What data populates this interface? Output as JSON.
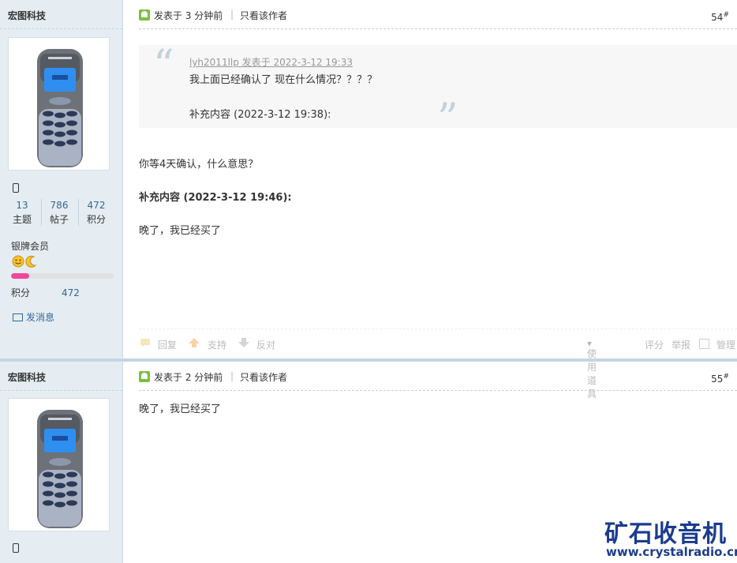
{
  "posts": [
    {
      "author": "宏图科技",
      "stats": [
        {
          "num": "13",
          "label": "主题"
        },
        {
          "num": "786",
          "label": "帖子"
        },
        {
          "num": "472",
          "label": "积分"
        }
      ],
      "rank": "银牌会员",
      "rank_progress": 0.18,
      "points_label": "积分",
      "points_value": "472",
      "send_msg": "发消息",
      "post_time": "发表于 3 分钟前",
      "only_author": "只看该作者",
      "floor": "54",
      "floor_mark": "#",
      "quote": {
        "author_line": "lyh2011llp 发表于 2022-3-12 19:33",
        "line1": "我上面已经确认了        现在什么情况？？？？",
        "line2": "补充内容 (2022-3-12 19:38):"
      },
      "text1": "你等4天确认，什么意思？",
      "text2": "补充内容 (2022-3-12 19:46):",
      "text3": "晚了，我已经买了",
      "footer": {
        "reply": "回复",
        "support": "支持",
        "oppose": "反对",
        "tools": "使用道具",
        "rate": "评分",
        "report": "举报",
        "manage": "管理"
      }
    },
    {
      "author": "宏图科技",
      "post_time": "发表于 2 分钟前",
      "only_author": "只看该作者",
      "floor": "55",
      "floor_mark": "#",
      "text1": "晚了，我已经买了"
    }
  ],
  "watermark": {
    "title": "矿石收音机",
    "url": "www.crystalradio.cn"
  },
  "colors": {
    "sidebar_bg": "#e5edf2",
    "link": "#336699",
    "progress": "#f0479a",
    "watermark": "#1a3c8e"
  }
}
